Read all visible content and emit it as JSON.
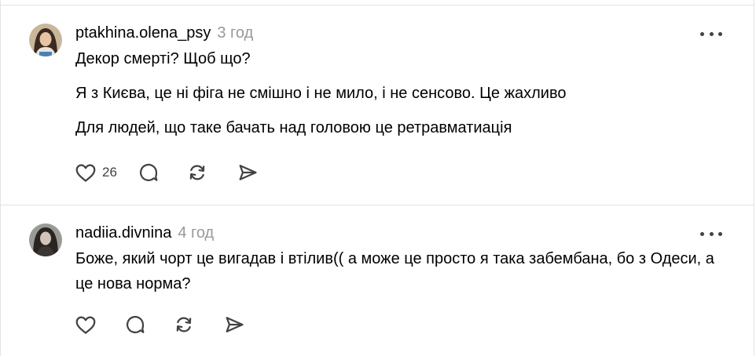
{
  "posts": [
    {
      "username": "ptakhina.olena_psy",
      "time": "3 год",
      "paragraphs": [
        "Декор смерті? Щоб що?",
        "Я з Києва, це ні фіга не смішно і не мило, і не сенсово. Це жахливо",
        "Для людей, що таке бачать над головою це ретравматиація"
      ],
      "like_count": "26"
    },
    {
      "username": "nadiia.divnina",
      "time": "4 год",
      "paragraphs": [
        "Боже, який чорт це вигадав і втілив(( а може це просто я така забембана, бо з Одеси, а це нова норма?"
      ],
      "like_count": ""
    }
  ],
  "icons": {
    "like": "heart-icon",
    "comment": "comment-bubble-icon",
    "repost": "repost-icon",
    "share": "send-icon",
    "more": "more-horizontal-icon"
  },
  "colors": {
    "text": "#000000",
    "muted": "#999999",
    "icon": "#424242",
    "divider": "#e3e3e3"
  }
}
